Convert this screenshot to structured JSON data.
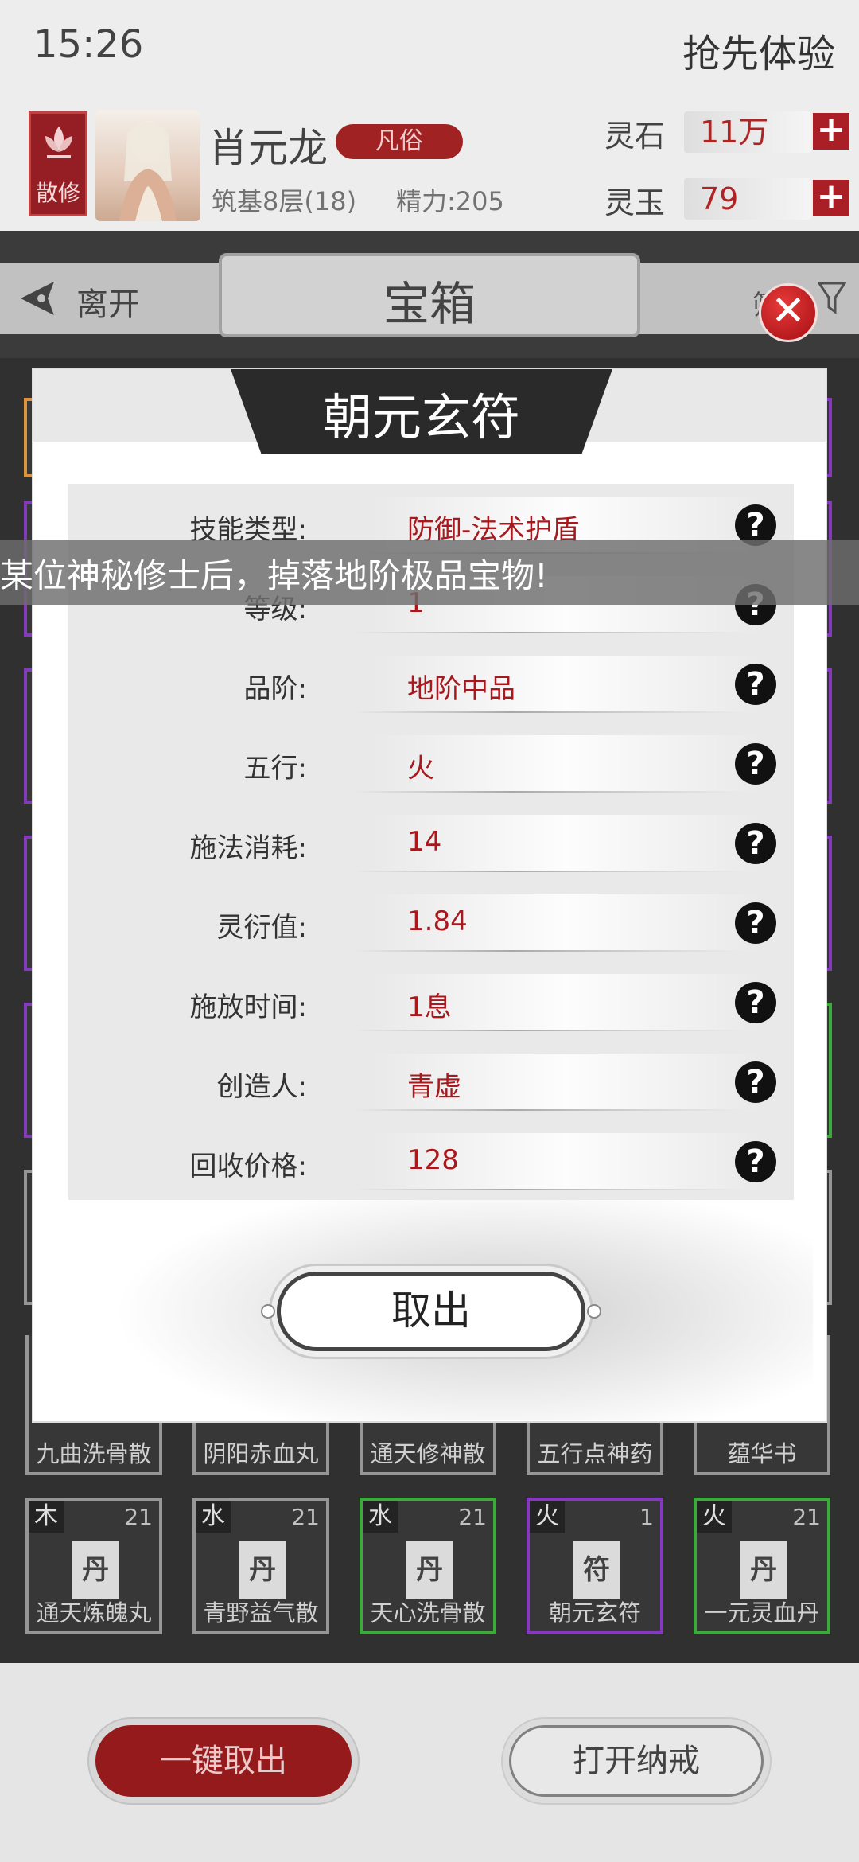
{
  "status_bar": {
    "time": "15:26",
    "right_text": "抢先体验"
  },
  "player": {
    "sect_badge": "散修",
    "name": "肖元龙",
    "rank": "凡俗",
    "realm": "筑基8层(18)",
    "energy": "精力:205"
  },
  "currencies": [
    {
      "label": "灵石",
      "value": "11万"
    },
    {
      "label": "灵玉",
      "value": "79"
    }
  ],
  "nav": {
    "back_label": "离开",
    "title": "宝箱",
    "filter_text": "筛"
  },
  "background_items": [
    {
      "name": "九曲洗骨散"
    },
    {
      "name": "阴阳赤血丸"
    },
    {
      "name": "通天修神散"
    },
    {
      "name": "五行点神药"
    },
    {
      "name": "蕴华书"
    }
  ],
  "bottom_row_items": [
    {
      "element": "木",
      "count": "21",
      "glyph": "丹",
      "name": "通天炼魄丸",
      "color": "#8e8e8e"
    },
    {
      "element": "水",
      "count": "21",
      "glyph": "丹",
      "name": "青野益气散",
      "color": "#8e8e8e"
    },
    {
      "element": "水",
      "count": "21",
      "glyph": "丹",
      "name": "天心洗骨散",
      "color": "#2ea32e"
    },
    {
      "element": "火",
      "count": "1",
      "glyph": "符",
      "name": "朝元玄符",
      "color": "#7a2ab8"
    },
    {
      "element": "火",
      "count": "21",
      "glyph": "丹",
      "name": "一元灵血丹",
      "color": "#2ea32e"
    }
  ],
  "bottom_buttons": {
    "take_all": "一键取出",
    "open_bag": "打开纳戒"
  },
  "marquee": "某位神秘修士后，掉落地阶极品宝物!",
  "modal": {
    "title": "朝元玄符",
    "attributes": [
      {
        "label": "技能类型:",
        "value": "防御-法术护盾"
      },
      {
        "label": "等级:",
        "value": "1"
      },
      {
        "label": "品阶:",
        "value": "地阶中品"
      },
      {
        "label": "五行:",
        "value": "火"
      },
      {
        "label": "施法消耗:",
        "value": "14"
      },
      {
        "label": "灵衍值:",
        "value": "1.84"
      },
      {
        "label": "施放时间:",
        "value": "1息"
      },
      {
        "label": "创造人:",
        "value": "青虚"
      },
      {
        "label": "回收价格:",
        "value": "128"
      }
    ],
    "take_button": "取出",
    "help_icon": "?",
    "close_icon": "✕"
  },
  "colors": {
    "accent_red": "#a30d14",
    "value_red": "#a8191e",
    "rare_purple": "#7a2ab8",
    "uncommon_green": "#2ea32e"
  }
}
